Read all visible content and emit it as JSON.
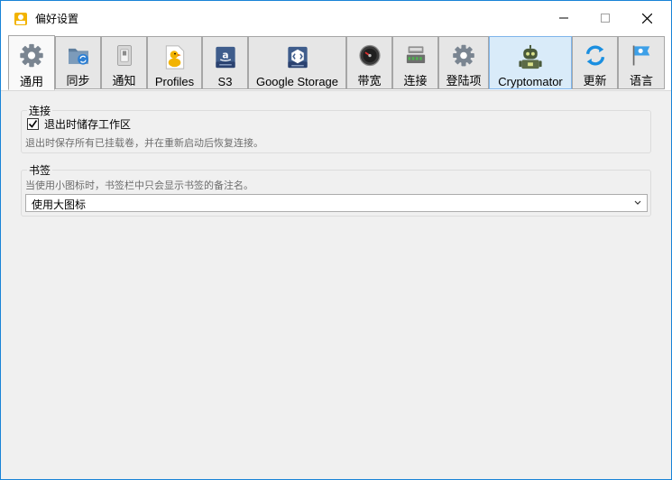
{
  "window": {
    "title": "偏好设置",
    "controls": [
      "minimize",
      "maximize",
      "close"
    ]
  },
  "tabs": [
    {
      "label": "通用",
      "icon": "gear-icon",
      "selected": true
    },
    {
      "label": "同步",
      "icon": "folder-sync-icon"
    },
    {
      "label": "通知",
      "icon": "switch-icon"
    },
    {
      "label": "Profiles",
      "icon": "duck-icon"
    },
    {
      "label": "S3",
      "icon": "amazon-drive-icon"
    },
    {
      "label": "Google Storage",
      "icon": "google-storage-icon"
    },
    {
      "label": "带宽",
      "icon": "gauge-icon"
    },
    {
      "label": "连接",
      "icon": "network-icon"
    },
    {
      "label": "登陆项",
      "icon": "gear-icon"
    },
    {
      "label": "Cryptomator",
      "icon": "robot-icon",
      "hover": true
    },
    {
      "label": "更新",
      "icon": "refresh-icon"
    },
    {
      "label": "语言",
      "icon": "flag-icon"
    }
  ],
  "connection": {
    "title": "连接",
    "checkbox_label": "退出时储存工作区",
    "checked": true,
    "description": "退出时保存所有已挂载卷，并在重新启动后恢复连接。"
  },
  "bookmarks": {
    "title": "书签",
    "description": "当使用小图标时，书签栏中只会显示书签的备注名。",
    "select_value": "使用大图标"
  },
  "colors": {
    "accent": "#1883d7",
    "tab_hover": "#d9ebf9",
    "tab_bg": "#e6e6e6"
  }
}
